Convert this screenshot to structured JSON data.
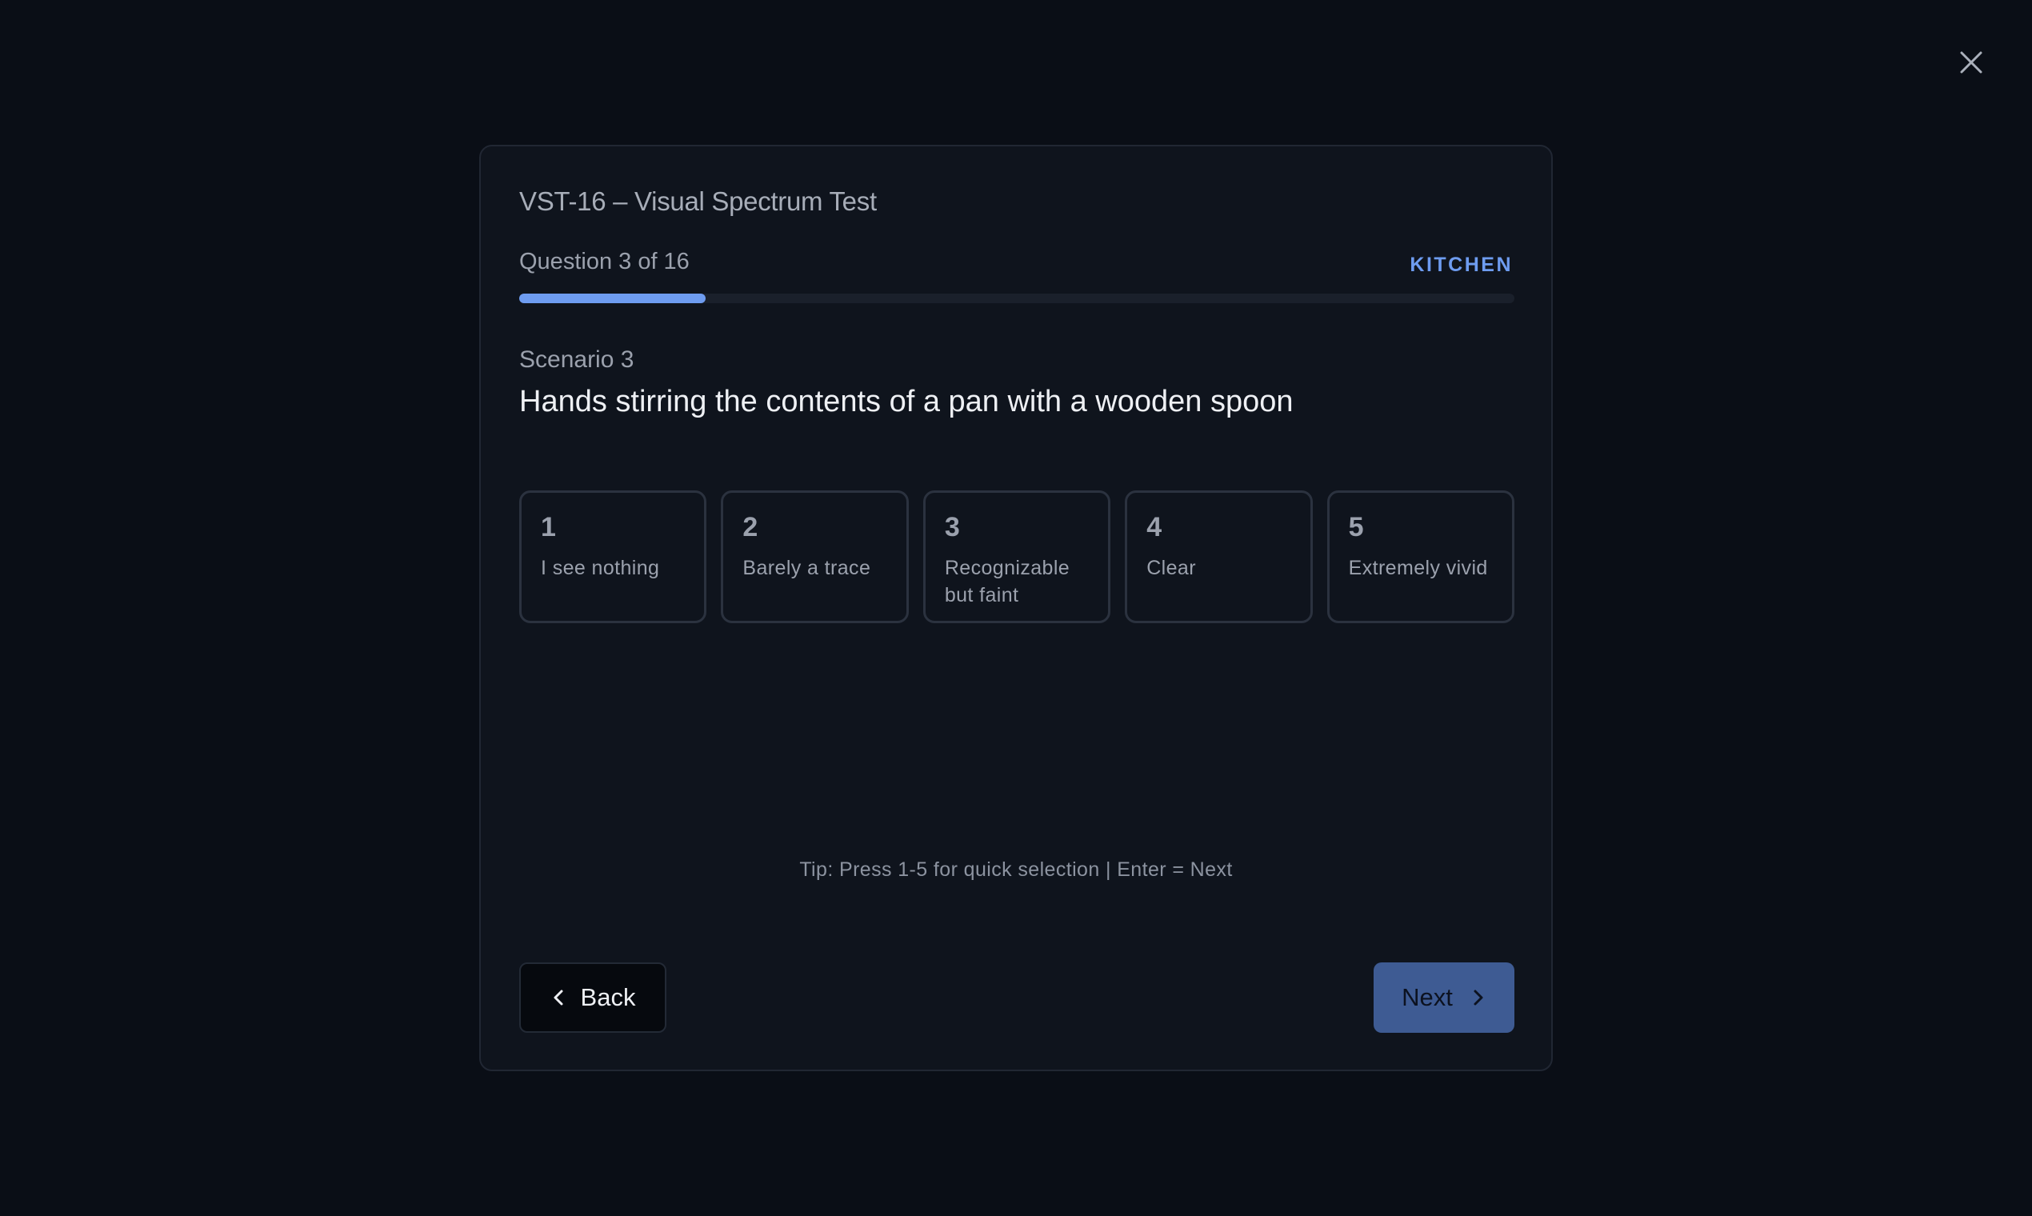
{
  "header": {
    "close_icon": "close-icon"
  },
  "quiz": {
    "test_title": "VST-16 – Visual Spectrum Test",
    "question_counter": "Question 3 of 16",
    "category": "KITCHEN",
    "progress_fraction": 0.1875,
    "scenario_label": "Scenario 3",
    "scenario_text": "Hands stirring the contents of a pan with a wooden spoon",
    "options": [
      {
        "number": "1",
        "label": "I see nothing"
      },
      {
        "number": "2",
        "label": "Barely a trace"
      },
      {
        "number": "3",
        "label": "Recognizable but faint"
      },
      {
        "number": "4",
        "label": "Clear"
      },
      {
        "number": "5",
        "label": "Extremely vivid"
      }
    ],
    "tip": "Tip: Press 1-5 for quick selection | Enter = Next"
  },
  "footer": {
    "back_label": "Back",
    "back_icon": "chevron-left-icon",
    "next_label": "Next",
    "next_icon": "chevron-right-icon"
  },
  "colors": {
    "accent": "#6e9cf0",
    "next_button": "#3e5b93",
    "background": "#0a0e16",
    "modal": "#0f141d"
  }
}
